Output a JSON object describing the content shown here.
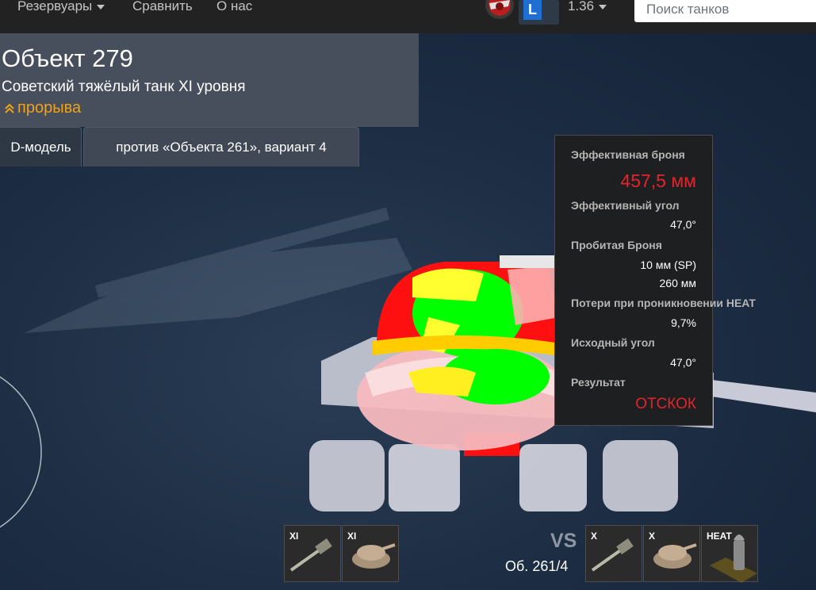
{
  "navbar": {
    "menu": [
      {
        "label": "Резервуары",
        "dropdown": true
      },
      {
        "label": "Сравнить",
        "dropdown": false
      },
      {
        "label": "О нас",
        "dropdown": false
      }
    ],
    "account_badge": "L",
    "version": "1.36",
    "search_placeholder": "Поиск танков"
  },
  "tank": {
    "name": "Объект 279",
    "subtitle": "Советский тяжёлый танк XI уровня",
    "role": "прорыва"
  },
  "tabs": [
    {
      "label": "D-модель",
      "active": true
    },
    {
      "label": "против «Объекта 261», вариант 4",
      "active": false
    }
  ],
  "tooltip": {
    "effective_armor_label": "Эффективная броня",
    "effective_armor_value": "457,5 мм",
    "effective_angle_label": "Эффективный угол",
    "effective_angle_value": "47,0°",
    "penetrated_label": "Пробитая Броня",
    "penetrated_value_1": "10 мм (SP)",
    "penetrated_value_2": "260 мм",
    "heat_loss_label": "Потери при проникновении HEAT",
    "heat_loss_value": "9,7%",
    "initial_angle_label": "Исходный угол",
    "initial_angle_value": "47,0°",
    "result_label": "Результат",
    "result_value": "ОТСКОК"
  },
  "loadout_own": [
    {
      "tier": "XI",
      "icon": "gun-icon"
    },
    {
      "tier": "XI",
      "icon": "turret-icon"
    }
  ],
  "vs": "VS",
  "enemy": "Об. 261/4",
  "loadout_enemy": [
    {
      "tier": "X",
      "icon": "gun-icon"
    },
    {
      "tier": "X",
      "icon": "turret-icon"
    },
    {
      "tier": "HEAT",
      "icon": "shell-icon"
    }
  ],
  "colors": {
    "accent_orange": "#f0a31a",
    "result_red": "#e8222a",
    "armor_green": "#00ff00",
    "armor_red": "#ff0000",
    "armor_yellow": "#ffff00"
  }
}
